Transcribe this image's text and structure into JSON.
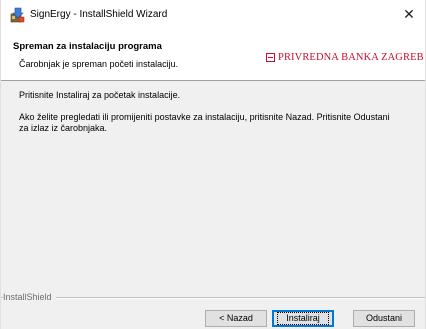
{
  "window": {
    "title": "SignErgy - InstallShield Wizard",
    "close_glyph": "✕"
  },
  "header": {
    "title": "Spreman za instalaciju programa",
    "subtitle": "Čarobnjak je spreman početi instalaciju.",
    "logo_text": "PRIVREDNA BANKA ZAGREB"
  },
  "content": {
    "line1": "Pritisnite Instaliraj za početak instalacije.",
    "paragraph": "Ako želite pregledati ili promijeniti postavke za instalaciju, pritisnite Nazad. Pritisnite Odustani za izlaz iz čarobnjaka."
  },
  "footer": {
    "brand": "InstallShield",
    "back_label": "< Nazad",
    "install_label": "Instaliraj",
    "cancel_label": "Odustani"
  },
  "colors": {
    "logo_red": "#c8102e",
    "default_button_border": "#0078d7"
  },
  "icons": {
    "app": "installer-icon",
    "close": "close-icon",
    "logo": "bank-logo-icon"
  }
}
